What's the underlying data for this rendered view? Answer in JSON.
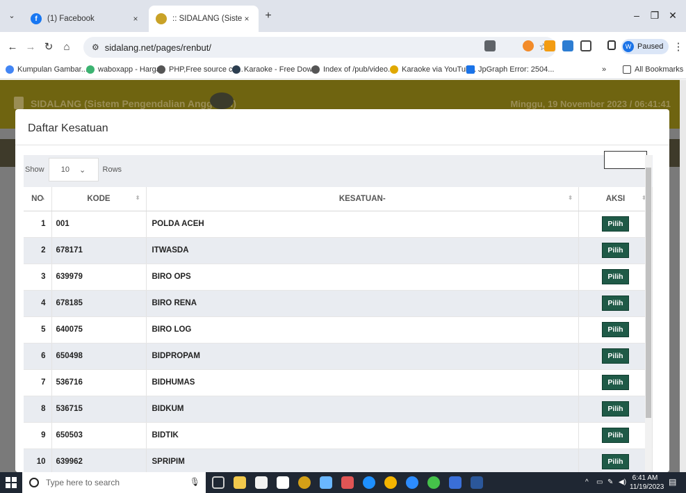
{
  "browser": {
    "tabs": [
      {
        "label": "(1) Facebook",
        "close": "×"
      },
      {
        "label": ":: SIDALANG (Sistem Pengenda",
        "close": "×"
      }
    ],
    "new_tab": "+",
    "window_controls": [
      "–",
      "❐",
      "✕"
    ],
    "url": "sidalang.net/pages/renbut/",
    "profile_status": "Paused",
    "profile_initial": "W",
    "bookmarks": [
      "Kumpulan Gambar...",
      "waboxapp - Harga",
      "PHP,Free source co...",
      "Karaoke - Free Dow...",
      "Index of /pub/video...",
      "Karaoke via YouTub...",
      "JpGraph Error: 2504..."
    ],
    "bookmarks_more": "»",
    "all_bookmarks": "All Bookmarks"
  },
  "site": {
    "title": "SIDALANG (Sistem Pengendalian Anggaran)",
    "date": "Minggu, 19 November 2023 / 06:41:41"
  },
  "modal": {
    "title": "Daftar Kesatuan",
    "show_label": "Show",
    "page_size": "10",
    "rows_label": "Rows",
    "columns": [
      "NO",
      "KODE",
      "KESATUAN-",
      "AKSI"
    ],
    "action_label": "Pilih",
    "rows": [
      {
        "no": "1",
        "kode": "001",
        "kesatuan": "POLDA ACEH"
      },
      {
        "no": "2",
        "kode": "678171",
        "kesatuan": "ITWASDA"
      },
      {
        "no": "3",
        "kode": "639979",
        "kesatuan": "BIRO OPS"
      },
      {
        "no": "4",
        "kode": "678185",
        "kesatuan": "BIRO RENA"
      },
      {
        "no": "5",
        "kode": "640075",
        "kesatuan": "BIRO LOG"
      },
      {
        "no": "6",
        "kode": "650498",
        "kesatuan": "BIDPROPAM"
      },
      {
        "no": "7",
        "kode": "536716",
        "kesatuan": "BIDHUMAS"
      },
      {
        "no": "8",
        "kode": "536715",
        "kesatuan": "BIDKUM"
      },
      {
        "no": "9",
        "kode": "650503",
        "kesatuan": "BIDTIK"
      },
      {
        "no": "10",
        "kode": "639962",
        "kesatuan": "SPRIPIM"
      }
    ]
  },
  "taskbar": {
    "search_placeholder": "Type here to search",
    "time": "6:41 AM",
    "date": "11/19/2023"
  },
  "colors": {
    "header_bg": "#6f6410",
    "pilih_bg": "#1f5a47",
    "row_alt": "#e9ecf1"
  }
}
